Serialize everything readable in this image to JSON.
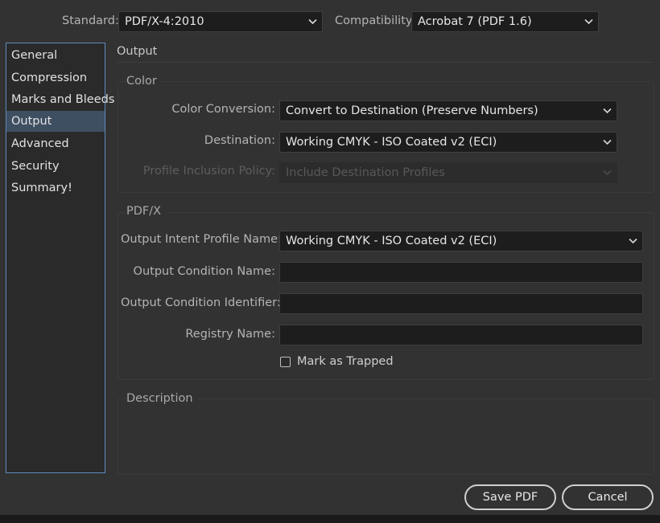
{
  "top": {
    "standard_label": "Standard:",
    "standard_value": "PDF/X-4:2010",
    "compat_label": "Compatibility:",
    "compat_value": "Acrobat 7 (PDF 1.6)"
  },
  "sidebar": {
    "items": [
      {
        "label": "General"
      },
      {
        "label": "Compression"
      },
      {
        "label": "Marks and Bleeds"
      },
      {
        "label": "Output"
      },
      {
        "label": "Advanced"
      },
      {
        "label": "Security"
      },
      {
        "label": "Summary!"
      }
    ],
    "selected": "Output"
  },
  "panel": {
    "title": "Output",
    "color": {
      "title": "Color",
      "conversion_label": "Color Conversion:",
      "conversion_value": "Convert to Destination (Preserve Numbers)",
      "destination_label": "Destination:",
      "destination_value": "Working CMYK - ISO Coated v2 (ECI)",
      "profile_label": "Profile Inclusion Policy:",
      "profile_value": "Include Destination Profiles"
    },
    "pdfx": {
      "title": "PDF/X",
      "intent_label": "Output Intent Profile Name:",
      "intent_value": "Working CMYK - ISO Coated v2 (ECI)",
      "condition_name_label": "Output Condition Name:",
      "condition_name_value": "",
      "condition_id_label": "Output Condition Identifier:",
      "condition_id_value": "",
      "registry_label": "Registry Name:",
      "registry_value": "",
      "trapped_label": "Mark as Trapped",
      "trapped_checked": false
    },
    "description": {
      "title": "Description"
    }
  },
  "buttons": {
    "save": "Save PDF",
    "cancel": "Cancel"
  },
  "colors": {
    "background": "#323232",
    "field": "#1d1d1d",
    "selection": "#3f4f62",
    "sidebar_border": "#5e8bbd"
  }
}
